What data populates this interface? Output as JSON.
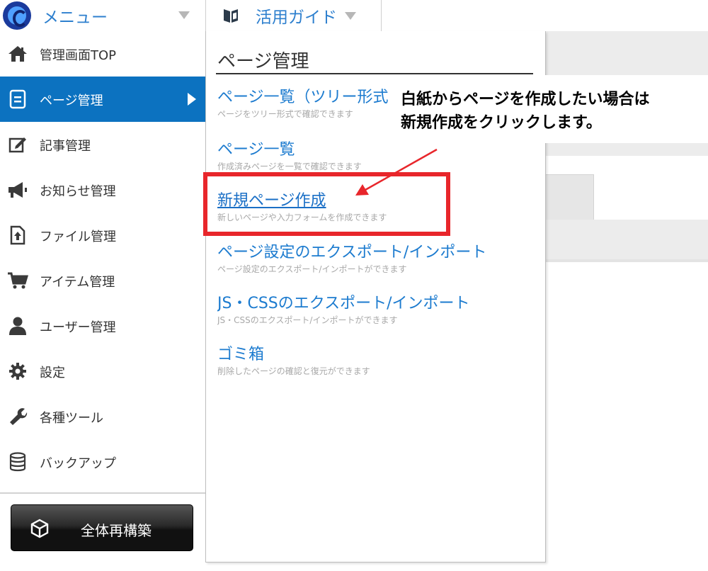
{
  "topbar": {
    "menu_label": "メニュー",
    "guide_label": "活用ガイド"
  },
  "sidebar": {
    "items": [
      {
        "label": "管理画面TOP",
        "icon": "home-icon"
      },
      {
        "label": "ページ管理",
        "icon": "page-icon",
        "active": true
      },
      {
        "label": "記事管理",
        "icon": "edit-icon"
      },
      {
        "label": "お知らせ管理",
        "icon": "megaphone-icon"
      },
      {
        "label": "ファイル管理",
        "icon": "file-upload-icon"
      },
      {
        "label": "アイテム管理",
        "icon": "cart-icon"
      },
      {
        "label": "ユーザー管理",
        "icon": "user-icon"
      },
      {
        "label": "設定",
        "icon": "gear-icon"
      },
      {
        "label": "各種ツール",
        "icon": "wrench-icon"
      },
      {
        "label": "バックアップ",
        "icon": "database-icon"
      }
    ],
    "rebuild_label": "全体再構築"
  },
  "panel": {
    "title": "ページ管理",
    "entries": [
      {
        "title": "ページ一覧（ツリー形式）",
        "desc": "ページをツリー形式で確認できます"
      },
      {
        "title": "ページ一覧",
        "desc": "作成済みページを一覧で確認できます"
      },
      {
        "title": "新規ページ作成",
        "desc": "新しいページや入力フォームを作成できます"
      },
      {
        "title": "ページ設定のエクスポート/インポート",
        "desc": "ページ設定のエクスポート/インポートができます"
      },
      {
        "title": "JS・CSSのエクスポート/インポート",
        "desc": "JS・CSSのエクスポート/インポートができます"
      },
      {
        "title": "ゴミ箱",
        "desc": "削除したページの確認と復元ができます"
      }
    ]
  },
  "annotation": {
    "line1": "白紙からページを作成したい場合は",
    "line2": "新規作成をクリックします。"
  },
  "colors": {
    "accent": "#0c72c0",
    "link": "#1c7bcf",
    "highlight": "#e8262b"
  }
}
